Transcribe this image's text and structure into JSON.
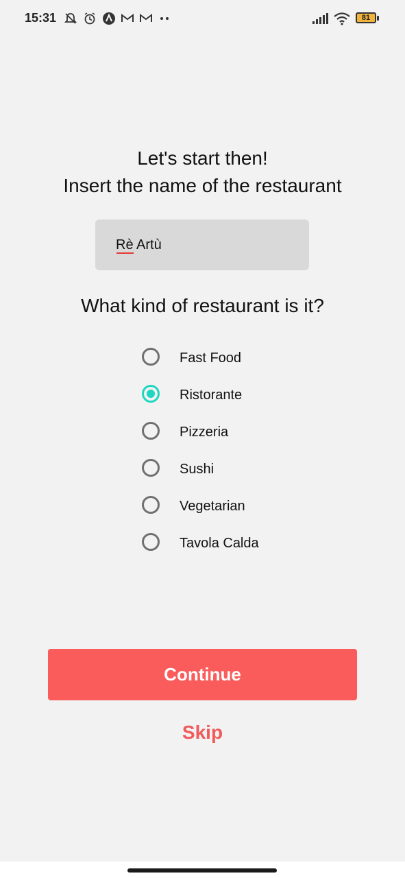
{
  "status_bar": {
    "time": "15:31",
    "battery": "81",
    "left_icons": [
      "mute-alarm-icon",
      "alarm-clock-icon",
      "app-a-icon",
      "gmail-icon",
      "gmail-icon",
      "more-dots-icon"
    ],
    "right_icons": [
      "signal-icon",
      "wifi-icon",
      "battery-icon"
    ]
  },
  "header": {
    "line1": "Let's start then!",
    "line2": "Insert the name of the restaurant"
  },
  "name_field": {
    "value": "Rè Artù"
  },
  "question": "What kind of restaurant is it?",
  "restaurant_types": [
    {
      "label": "Fast Food",
      "selected": false
    },
    {
      "label": "Ristorante",
      "selected": true
    },
    {
      "label": "Pizzeria",
      "selected": false
    },
    {
      "label": "Sushi",
      "selected": false
    },
    {
      "label": "Vegetarian",
      "selected": false
    },
    {
      "label": "Tavola Calda",
      "selected": false
    }
  ],
  "buttons": {
    "continue": "Continue",
    "skip": "Skip"
  },
  "colors": {
    "accent": "#fa5c5c",
    "radio_selected": "#1fd6c0",
    "background": "#f2f2f2",
    "field_bg": "#d9d9d9"
  }
}
